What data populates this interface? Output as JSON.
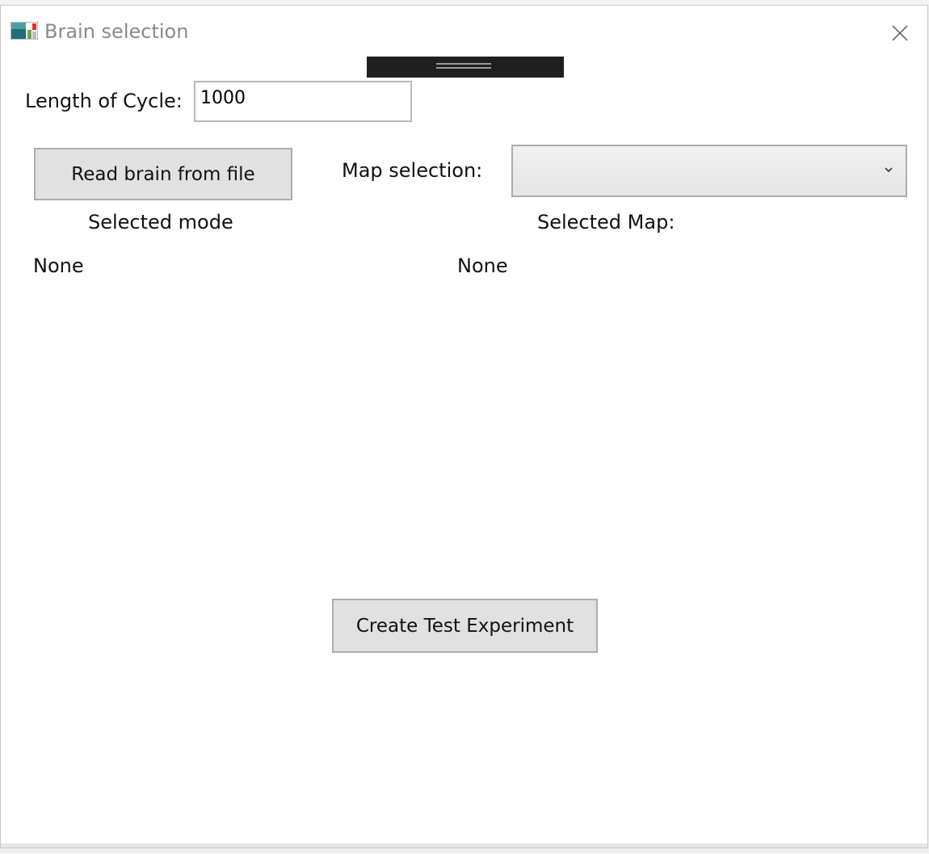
{
  "window": {
    "title": "Brain selection",
    "close_glyph": "✕"
  },
  "form": {
    "cycle_label": "Length of Cycle:",
    "cycle_value": "1000",
    "read_brain_button": "Read brain from file",
    "map_selection_label": "Map selection:",
    "map_selection_value": "",
    "selected_mode_label": "Selected  mode",
    "selected_mode_value": "None",
    "selected_map_label": "Selected  Map:",
    "selected_map_value": "None",
    "create_button": "Create Test Experiment"
  },
  "icons": {
    "app": "app-icon",
    "close": "close-icon",
    "dropdown": "chevron-down-icon",
    "grip": "grip-icon"
  },
  "colors": {
    "button_bg": "#e1e1e1",
    "title_text": "#8a8a8a",
    "handle_bg": "#1f1f1f"
  }
}
